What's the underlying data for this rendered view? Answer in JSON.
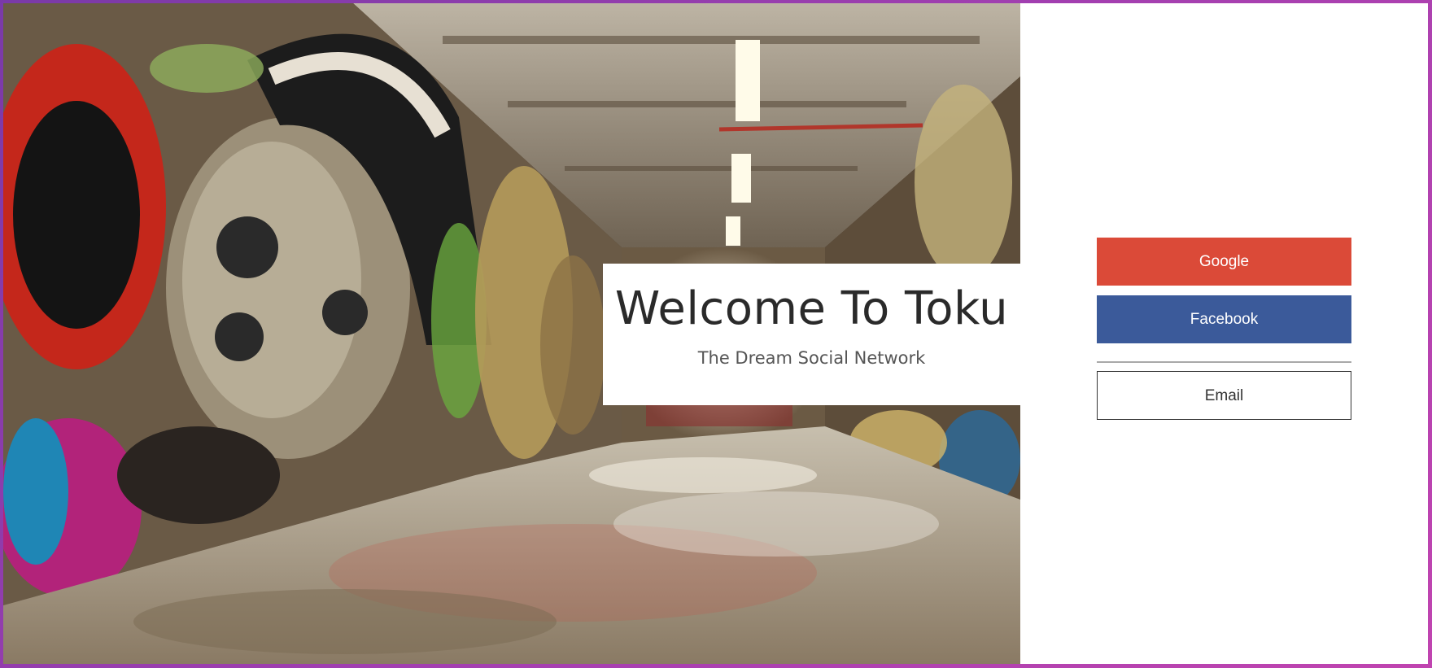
{
  "welcome": {
    "title": "Welcome To Toku",
    "subtitle": "The Dream Social Network"
  },
  "auth": {
    "google_label": "Google",
    "facebook_label": "Facebook",
    "email_label": "Email"
  },
  "colors": {
    "google": "#db4a38",
    "facebook": "#3b5a9a",
    "email_border": "#333333",
    "frame_border": "#a23fb0"
  },
  "hero": {
    "image": "graffiti-tunnel-photo"
  }
}
